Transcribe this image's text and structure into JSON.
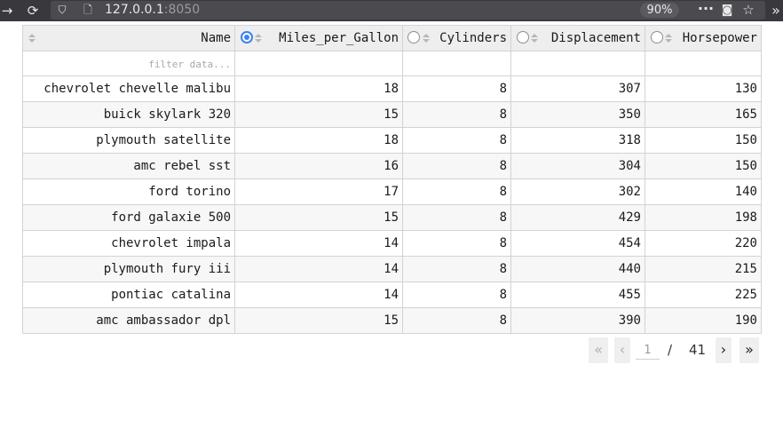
{
  "browser": {
    "url_host": "127.0.0.1",
    "url_port": ":8050",
    "zoom": "90%",
    "icons": [
      "back-arrow-icon",
      "reload-icon",
      "shield-icon",
      "page-icon",
      "more-icon",
      "pocket-icon",
      "bookmark-star-icon",
      "overflow-chevron-icon"
    ]
  },
  "table": {
    "columns": [
      {
        "key": "name",
        "label": "Name"
      },
      {
        "key": "mpg",
        "label": "Miles_per_Gallon"
      },
      {
        "key": "cyl",
        "label": "Cylinders"
      },
      {
        "key": "disp",
        "label": "Displacement"
      },
      {
        "key": "hp",
        "label": "Horsepower"
      }
    ],
    "selected_column": "Miles_per_Gallon",
    "filter_placeholder": "filter data...",
    "rows": [
      [
        "chevrolet chevelle malibu",
        "18",
        "8",
        "307",
        "130"
      ],
      [
        "buick skylark 320",
        "15",
        "8",
        "350",
        "165"
      ],
      [
        "plymouth satellite",
        "18",
        "8",
        "318",
        "150"
      ],
      [
        "amc rebel sst",
        "16",
        "8",
        "304",
        "150"
      ],
      [
        "ford torino",
        "17",
        "8",
        "302",
        "140"
      ],
      [
        "ford galaxie 500",
        "15",
        "8",
        "429",
        "198"
      ],
      [
        "chevrolet impala",
        "14",
        "8",
        "454",
        "220"
      ],
      [
        "plymouth fury iii",
        "14",
        "8",
        "440",
        "215"
      ],
      [
        "pontiac catalina",
        "14",
        "8",
        "455",
        "225"
      ],
      [
        "amc ambassador dpl",
        "15",
        "8",
        "390",
        "190"
      ]
    ]
  },
  "pagination": {
    "current_page": "1",
    "separator": "/",
    "total_pages": "41",
    "first_symbol": "«",
    "prev_symbol": "‹",
    "next_symbol": "›",
    "last_symbol": "»"
  },
  "colors": {
    "toolbar": "#38383d",
    "accent": "#3b83f0",
    "header_bg": "#eeeeee",
    "stripe": "#f7f7f7",
    "border": "#d3d3d3"
  }
}
